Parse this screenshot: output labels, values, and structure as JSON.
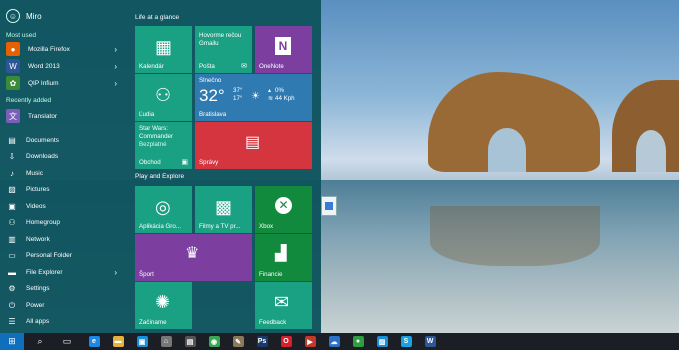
{
  "user": {
    "name": "Miro"
  },
  "most_used": {
    "label": "Most used",
    "apps": [
      {
        "label": "Mozilla Firefox",
        "icon": "firefox-icon",
        "color": "#e66000"
      },
      {
        "label": "Word 2013",
        "icon": "word-icon",
        "color": "#2b5797"
      },
      {
        "label": "QIP Infium",
        "icon": "qip-icon",
        "color": "#3a8a3a"
      }
    ]
  },
  "recently_added": {
    "label": "Recently added",
    "apps": [
      {
        "label": "Translator",
        "icon": "translator-icon",
        "color": "#7a5fb8"
      }
    ]
  },
  "system_items": [
    {
      "label": "Documents",
      "icon": "documents-icon"
    },
    {
      "label": "Downloads",
      "icon": "downloads-icon"
    },
    {
      "label": "Music",
      "icon": "music-icon"
    },
    {
      "label": "Pictures",
      "icon": "pictures-icon"
    },
    {
      "label": "Videos",
      "icon": "videos-icon"
    },
    {
      "label": "Homegroup",
      "icon": "homegroup-icon"
    },
    {
      "label": "Network",
      "icon": "network-icon"
    },
    {
      "label": "Personal Folder",
      "icon": "folder-icon"
    },
    {
      "label": "File Explorer",
      "icon": "file-explorer-icon"
    },
    {
      "label": "Settings",
      "icon": "gear-icon"
    },
    {
      "label": "Power",
      "icon": "power-icon"
    },
    {
      "label": "All apps",
      "icon": "all-apps-icon"
    }
  ],
  "groups": {
    "life": "Life at a glance",
    "play": "Play and Explore"
  },
  "tiles": {
    "calendar": "Kalendár",
    "mail_title": "Hovorme rečou Gmailu",
    "mail": "Pošta",
    "onenote": "OneNote",
    "people": "Ľudia",
    "weather": {
      "condition": "Slnečno",
      "temp": "32°",
      "high": "37°",
      "low": "17°",
      "rain": "0%",
      "wind": "44 Kph",
      "city": "Bratislava"
    },
    "store_title": "Star Wars: Commander",
    "store_sub": "Bezplatné",
    "store": "Obchod",
    "news": "Správy",
    "xbox_companion": "Aplikácia Gro...",
    "movies": "Filmy a TV pr...",
    "xbox": "Xbox",
    "sport": "Šport",
    "finance": "Financie",
    "get_started": "Začíname",
    "feedback": "Feedback"
  },
  "taskbar": [
    {
      "icon": "search-icon",
      "glyph": "⌕"
    },
    {
      "icon": "task-view-icon",
      "glyph": "▭"
    },
    {
      "icon": "edge-icon",
      "glyph": "e",
      "color": "#1e88e5"
    },
    {
      "icon": "file-explorer-icon",
      "glyph": "▬",
      "color": "#e3b341"
    },
    {
      "icon": "store-icon",
      "glyph": "▣",
      "color": "#1a8fd8"
    },
    {
      "icon": "network-app-icon",
      "glyph": "⌂",
      "color": "#777"
    },
    {
      "icon": "calculator-icon",
      "glyph": "▤",
      "color": "#555"
    },
    {
      "icon": "chrome-icon",
      "glyph": "◉",
      "color": "#3aa757"
    },
    {
      "icon": "gimp-icon",
      "glyph": "✎",
      "color": "#8a7a5a"
    },
    {
      "icon": "photoshop-icon",
      "glyph": "Ps",
      "color": "#1a3a6e"
    },
    {
      "icon": "opera-icon",
      "glyph": "O",
      "color": "#d8202c"
    },
    {
      "icon": "media-icon",
      "glyph": "▶",
      "color": "#c0392b"
    },
    {
      "icon": "cloud-icon",
      "glyph": "☁",
      "color": "#2b70c9"
    },
    {
      "icon": "qip-taskbar-icon",
      "glyph": "●",
      "color": "#2e9e3e"
    },
    {
      "icon": "photos-icon",
      "glyph": "▨",
      "color": "#1a8fd8"
    },
    {
      "icon": "skype-icon",
      "glyph": "S",
      "color": "#1aa1e1"
    },
    {
      "icon": "word-taskbar-icon",
      "glyph": "W",
      "color": "#2b5797"
    }
  ]
}
